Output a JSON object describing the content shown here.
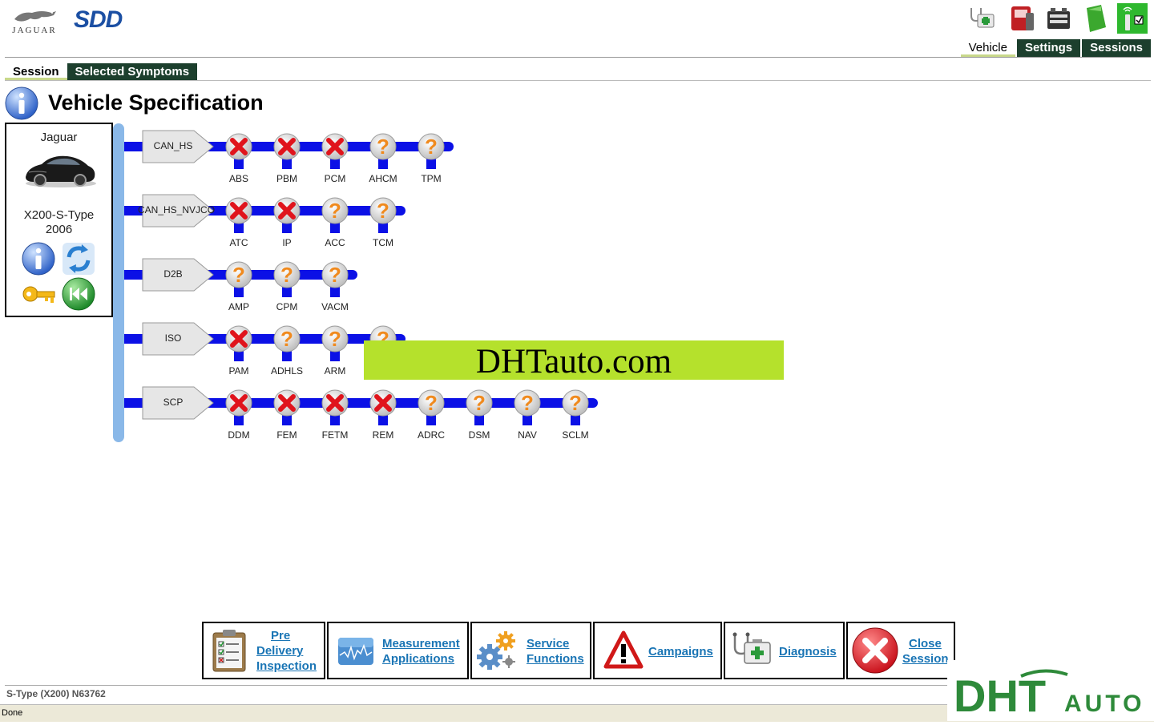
{
  "header": {
    "brand": "JAGUAR",
    "app": "SDD",
    "nav_tabs": [
      {
        "label": "Vehicle",
        "active": true
      },
      {
        "label": "Settings",
        "active": false
      },
      {
        "label": "Sessions",
        "active": false
      }
    ],
    "sub_tabs": [
      {
        "label": "Session",
        "active": true
      },
      {
        "label": "Selected Symptoms",
        "active": false
      }
    ]
  },
  "page": {
    "title": "Vehicle Specification"
  },
  "vehicle": {
    "make": "Jaguar",
    "model": "X200-S-Type",
    "year": "2006"
  },
  "network": {
    "buses": [
      {
        "name": "CAN_HS",
        "modules": [
          {
            "name": "ABS",
            "status": "error"
          },
          {
            "name": "PBM",
            "status": "error"
          },
          {
            "name": "PCM",
            "status": "error"
          },
          {
            "name": "AHCM",
            "status": "unknown"
          },
          {
            "name": "TPM",
            "status": "unknown"
          }
        ]
      },
      {
        "name": "CAN_HS_NVJCO",
        "modules": [
          {
            "name": "ATC",
            "status": "error"
          },
          {
            "name": "IP",
            "status": "error"
          },
          {
            "name": "ACC",
            "status": "unknown"
          },
          {
            "name": "TCM",
            "status": "unknown"
          }
        ]
      },
      {
        "name": "D2B",
        "modules": [
          {
            "name": "AMP",
            "status": "unknown"
          },
          {
            "name": "CPM",
            "status": "unknown"
          },
          {
            "name": "VACM",
            "status": "unknown"
          }
        ]
      },
      {
        "name": "ISO",
        "modules": [
          {
            "name": "PAM",
            "status": "error"
          },
          {
            "name": "ADHLS",
            "status": "unknown"
          },
          {
            "name": "ARM",
            "status": "unknown"
          },
          {
            "name": "",
            "status": "unknown"
          }
        ]
      },
      {
        "name": "SCP",
        "modules": [
          {
            "name": "DDM",
            "status": "error"
          },
          {
            "name": "FEM",
            "status": "error"
          },
          {
            "name": "FETM",
            "status": "error"
          },
          {
            "name": "REM",
            "status": "error"
          },
          {
            "name": "ADRC",
            "status": "unknown"
          },
          {
            "name": "DSM",
            "status": "unknown"
          },
          {
            "name": "NAV",
            "status": "unknown"
          },
          {
            "name": "SCLM",
            "status": "unknown"
          }
        ]
      }
    ]
  },
  "watermark": {
    "text": "DHTauto.com"
  },
  "toolbar": [
    {
      "id": "pdi",
      "lines": [
        "Pre",
        "Delivery",
        "Inspection"
      ],
      "icon": "clipboard-icon"
    },
    {
      "id": "measurement",
      "lines": [
        "Measurement",
        "Applications"
      ],
      "icon": "waveform-icon"
    },
    {
      "id": "service",
      "lines": [
        "Service",
        "Functions"
      ],
      "icon": "gears-icon"
    },
    {
      "id": "campaigns",
      "lines": [
        "Campaigns"
      ],
      "icon": "warning-icon"
    },
    {
      "id": "diagnosis",
      "lines": [
        "Diagnosis"
      ],
      "icon": "stethoscope-kit-icon"
    },
    {
      "id": "close",
      "lines": [
        "Close",
        "Session"
      ],
      "icon": "close-red-icon"
    }
  ],
  "status": {
    "vehicle_line": "S-Type (X200) N63762",
    "browser": "Done"
  },
  "brand_logo": {
    "main": "DHT",
    "sub": "AUTO"
  },
  "colors": {
    "dark_green": "#1c3f2d",
    "bus_blue": "#0b10e6",
    "trunk_blue": "#8ab8e8",
    "link_blue": "#1a75b5",
    "error_red": "#e0141c",
    "unknown_orange": "#f08a1e"
  }
}
